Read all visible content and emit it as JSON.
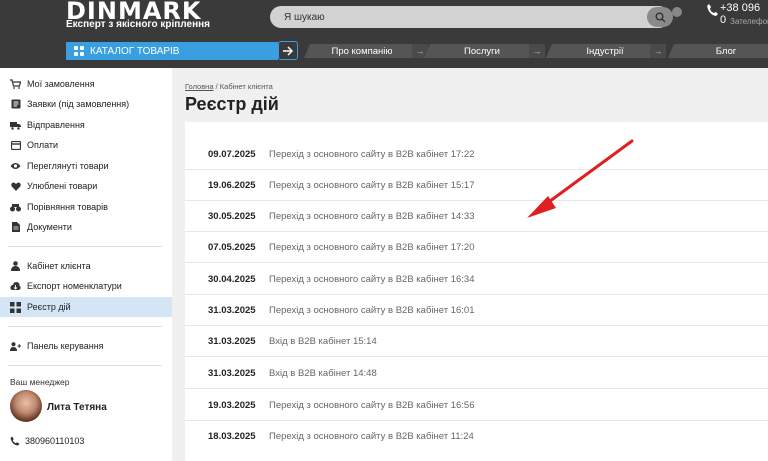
{
  "header": {
    "logo": "DINMARK",
    "tagline": "Експерт з якісного кріплення",
    "search_placeholder": "Я шукаю",
    "phone": "+38 096 0",
    "phone_sub": "Зателефон"
  },
  "nav": {
    "catalog_label": "КАТАЛОГ ТОВАРІВ",
    "items": [
      "Про компанію",
      "Послуги",
      "Індустрії",
      "Блог"
    ]
  },
  "sidebar": {
    "items": [
      {
        "label": "Мої замовлення",
        "icon": "cart-icon"
      },
      {
        "label": "Заявки (під замовлення)",
        "icon": "list-icon"
      },
      {
        "label": "Відправлення",
        "icon": "truck-icon"
      },
      {
        "label": "Оплати",
        "icon": "wallet-icon"
      },
      {
        "label": "Переглянуті товари",
        "icon": "eye-icon"
      },
      {
        "label": "Улюблені товари",
        "icon": "heart-icon"
      },
      {
        "label": "Порівняння товарів",
        "icon": "compare-icon"
      },
      {
        "label": "Документи",
        "icon": "document-icon"
      }
    ],
    "account_items": [
      {
        "label": "Кабінет клієнта",
        "icon": "user-icon"
      },
      {
        "label": "Експорт номенклатури",
        "icon": "export-icon"
      },
      {
        "label": "Реєстр дій",
        "icon": "register-icon",
        "active": true
      }
    ],
    "control_item": {
      "label": "Панель керування",
      "icon": "users-icon"
    },
    "manager": {
      "title": "Ваш менеджер",
      "name": "Лита Тетяна",
      "phone": "380960110103"
    }
  },
  "breadcrumb": {
    "home": "Головна",
    "separator": "/",
    "current": "Кабінет клієнта"
  },
  "page_title": "Реєстр дій",
  "log": [
    {
      "date": "09.07.2025",
      "text": "Перехід з основного сайту в B2B кабінет 17:22"
    },
    {
      "date": "19.06.2025",
      "text": "Перехід з основного сайту в B2B кабінет 15:17"
    },
    {
      "date": "30.05.2025",
      "text": "Перехід з основного сайту в B2B кабінет 14:33"
    },
    {
      "date": "07.05.2025",
      "text": "Перехід з основного сайту в B2B кабінет 17:20"
    },
    {
      "date": "30.04.2025",
      "text": "Перехід з основного сайту в B2B кабінет 16:34"
    },
    {
      "date": "31.03.2025",
      "text": "Перехід з основного сайту в B2B кабінет 16:01"
    },
    {
      "date": "31.03.2025",
      "text": "Вхід в B2B кабінет 15:14"
    },
    {
      "date": "31.03.2025",
      "text": "Вхід в B2B кабінет 14:48"
    },
    {
      "date": "19.03.2025",
      "text": "Перехід з основного сайту в B2B кабінет 16:56"
    },
    {
      "date": "18.03.2025",
      "text": "Перехід з основного сайту в B2B кабінет 11:24"
    }
  ],
  "colors": {
    "accent": "#3a9fe0",
    "header_bg": "#3a3a3a",
    "active_bg": "#d4e6f6",
    "annotation": "#e02020"
  }
}
